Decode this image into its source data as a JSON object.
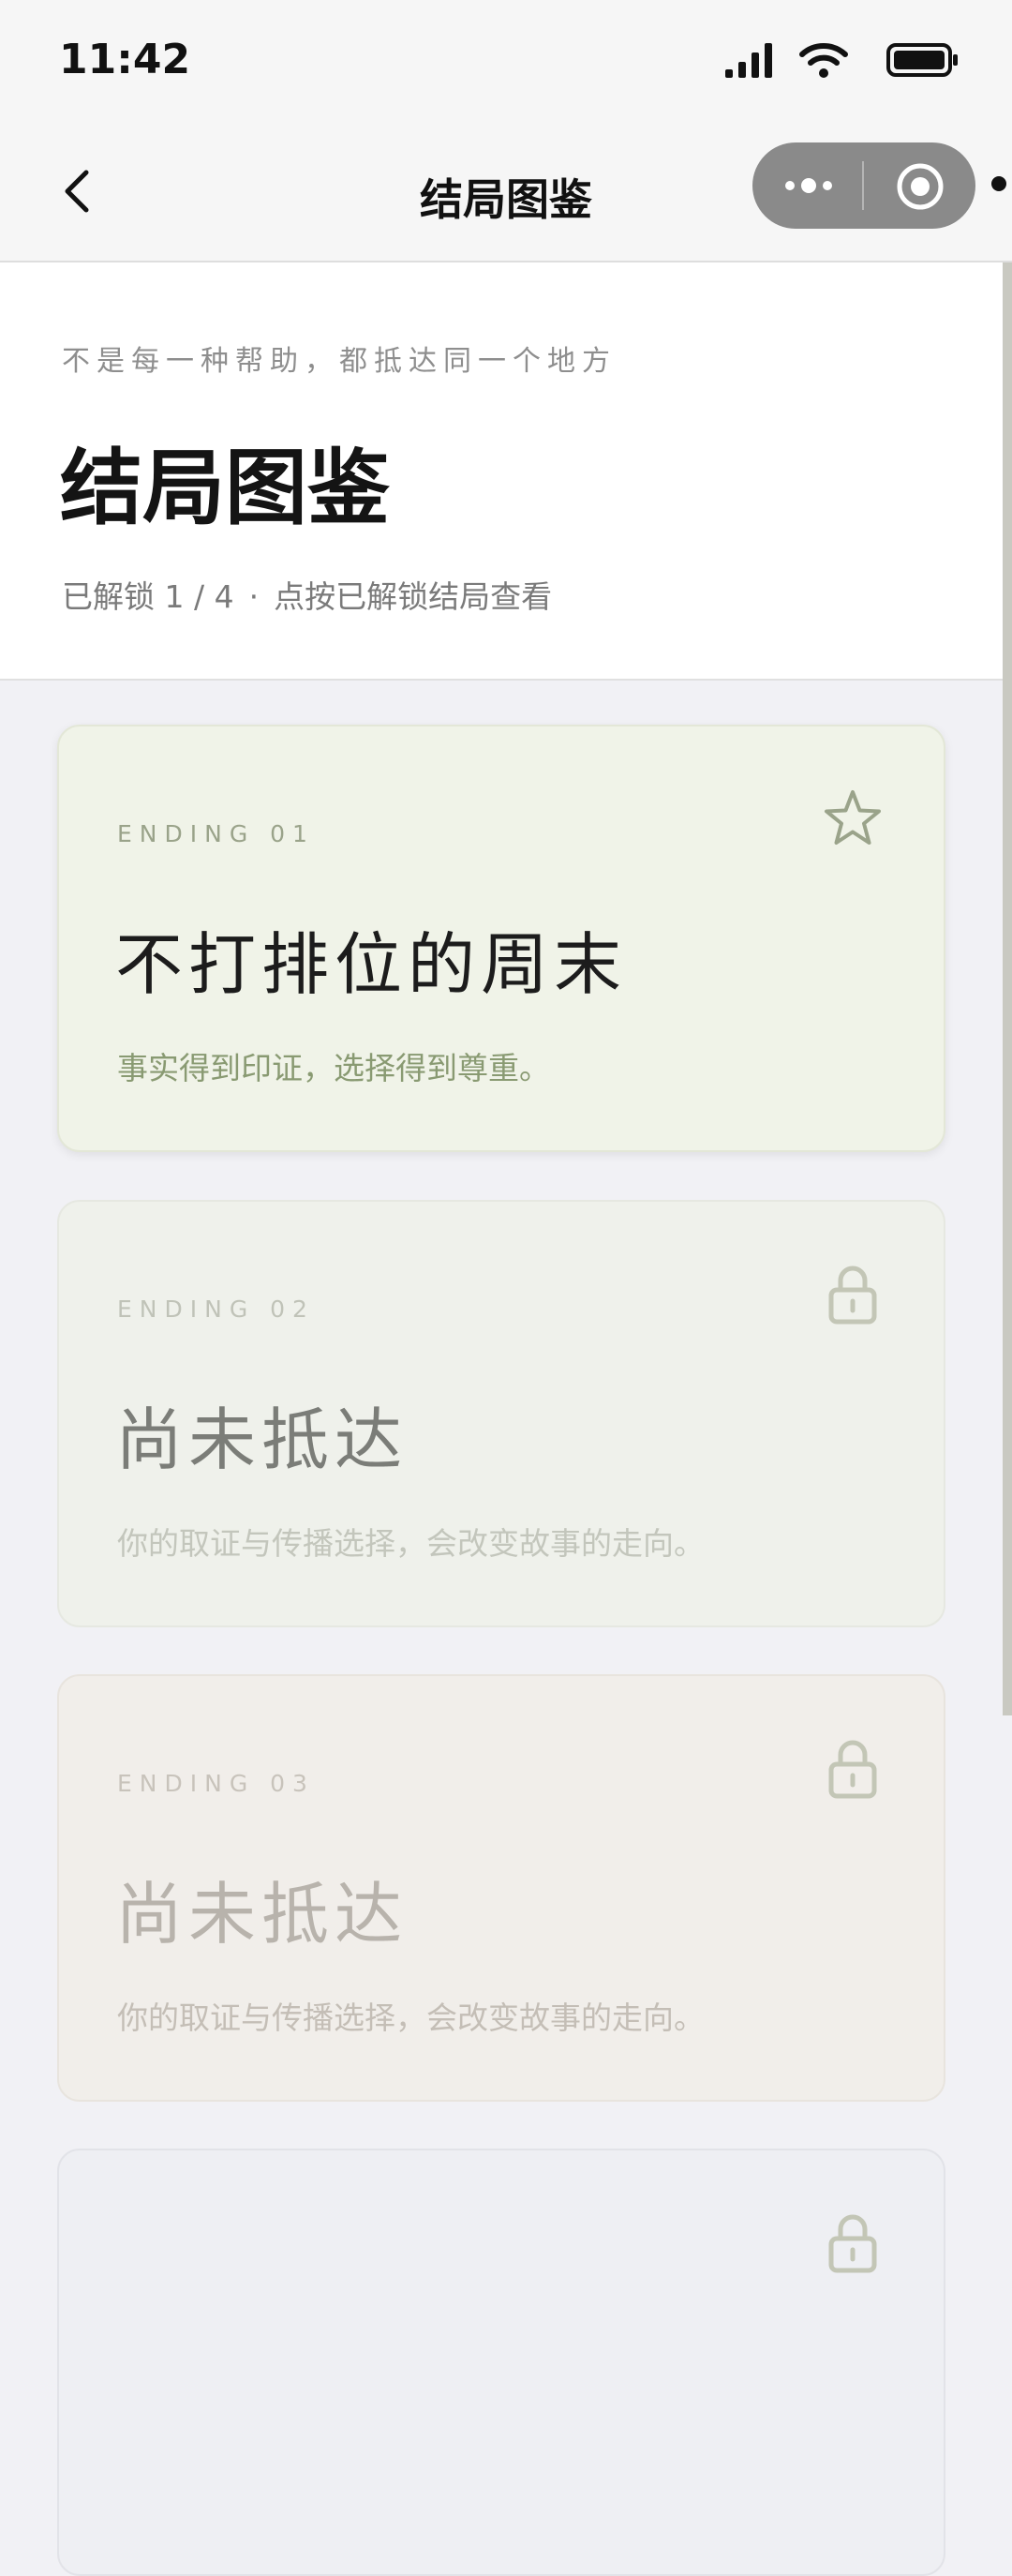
{
  "status_bar": {
    "time": "11:42"
  },
  "nav": {
    "title": "结局图鉴"
  },
  "header": {
    "tagline": "不是每一种帮助，都抵达同一个地方",
    "title": "结局图鉴",
    "unlocked_label": "已解锁 1 / 4",
    "separator": "·",
    "hint": "点按已解锁结局查看"
  },
  "endings": [
    {
      "label": "ENDING 01",
      "title": "不打排位的周末",
      "description": "事实得到印证，选择得到尊重。",
      "icon": "star-icon",
      "status": "unlocked"
    },
    {
      "label": "ENDING 02",
      "title": "尚未抵达",
      "description": "你的取证与传播选择，会改变故事的走向。",
      "icon": "lock-icon",
      "status": "locked"
    },
    {
      "label": "ENDING 03",
      "title": "尚未抵达",
      "description": "你的取证与传播选择，会改变故事的走向。",
      "icon": "lock-icon",
      "status": "locked"
    },
    {
      "label": "",
      "title": "",
      "description": "",
      "icon": "lock-icon",
      "status": "locked"
    }
  ],
  "colors": {
    "unlocked_card": "#f0f3e8",
    "locked_card_green": "#eff1eb",
    "locked_card_beige": "#f1eeea",
    "page_background": "#f1f1f5",
    "icon_tint": "#9aa38a"
  }
}
